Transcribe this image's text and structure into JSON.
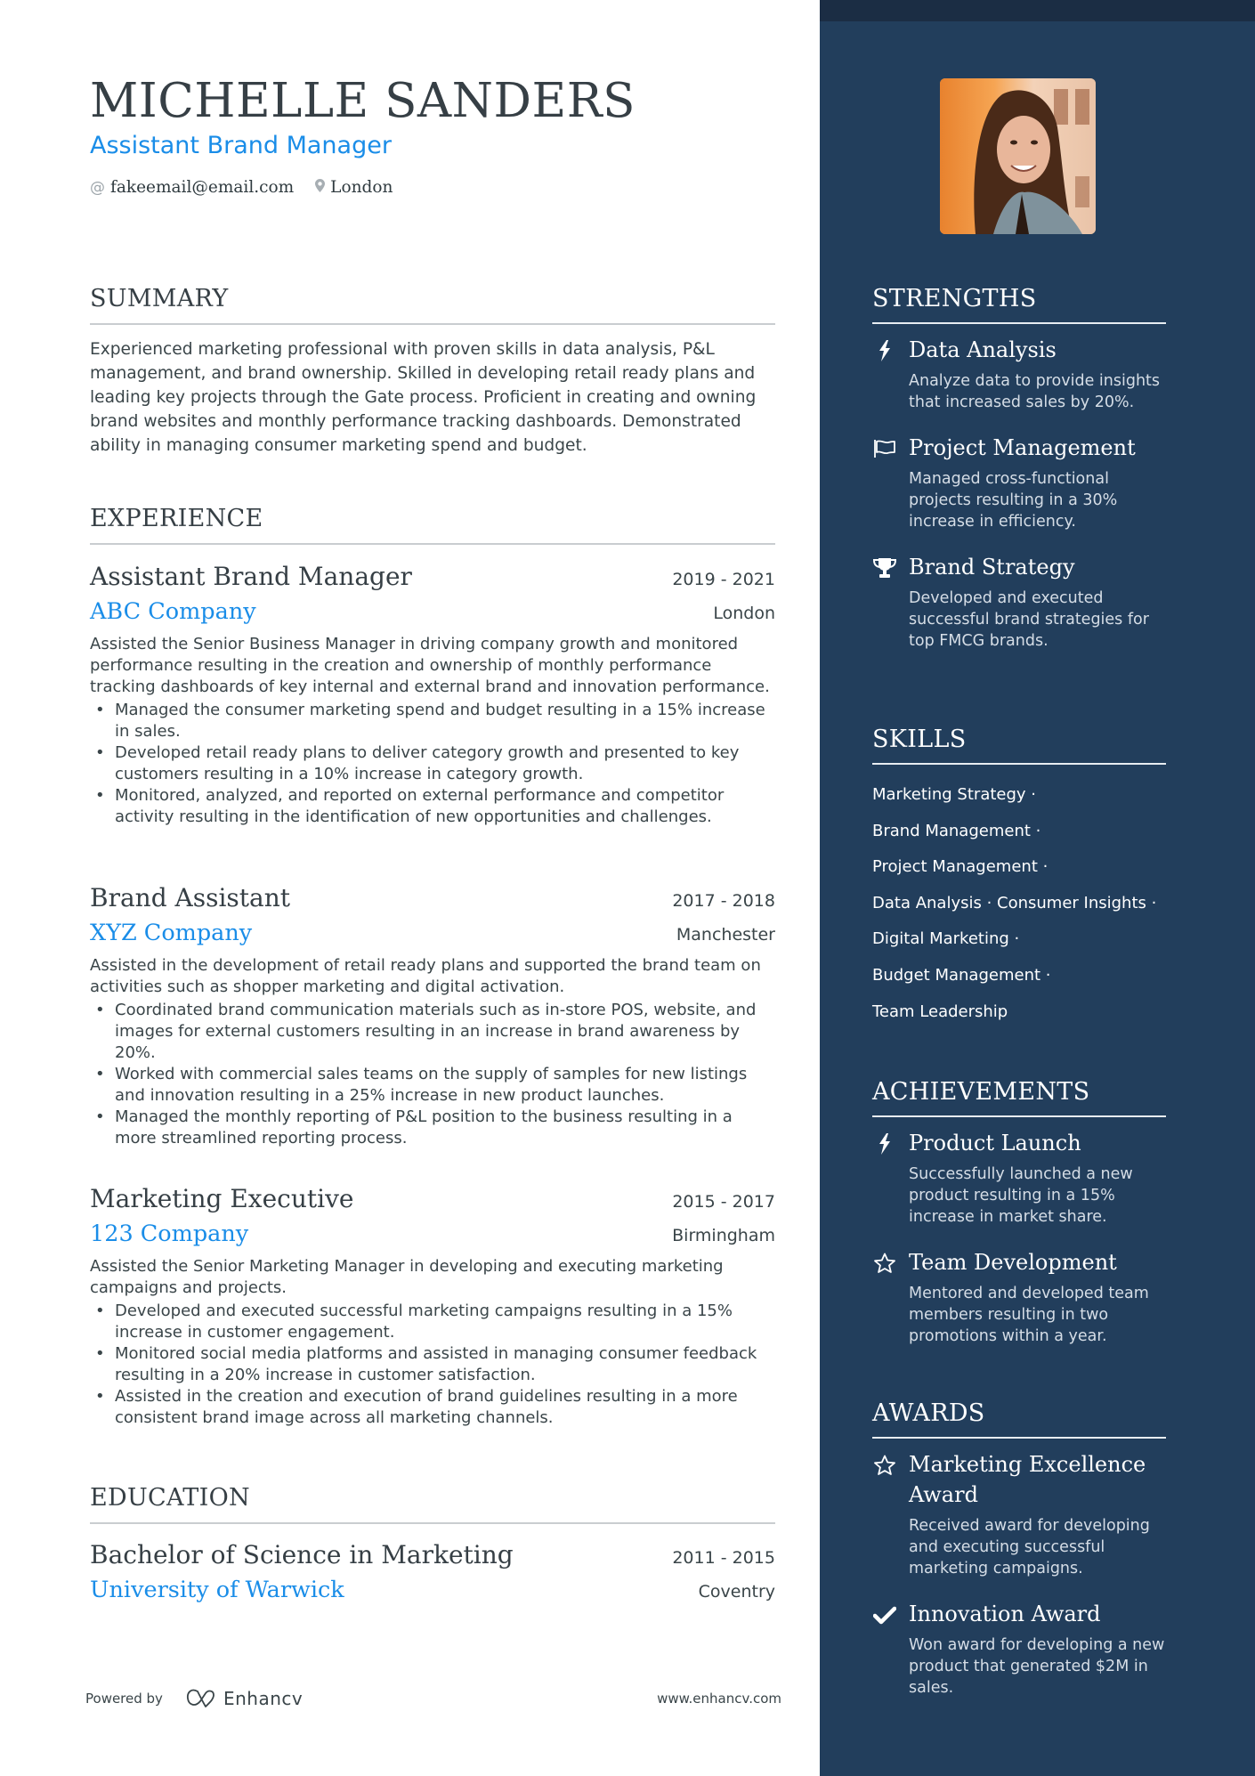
{
  "header": {
    "name": "MICHELLE SANDERS",
    "title": "Assistant Brand Manager",
    "email": "fakeemail@email.com",
    "location": "London",
    "email_icon": "at-icon",
    "location_icon": "map-pin-icon"
  },
  "summary": {
    "heading": "SUMMARY",
    "text": "Experienced marketing professional with proven skills in data analysis, P&L management, and brand ownership. Skilled in developing retail ready plans and leading key projects through the Gate process. Proficient in creating and owning brand websites and monthly performance tracking dashboards. Demonstrated ability in managing consumer marketing spend and budget."
  },
  "experience": {
    "heading": "EXPERIENCE",
    "jobs": [
      {
        "title": "Assistant Brand Manager",
        "dates": "2019 - 2021",
        "company": "ABC Company",
        "location": "London",
        "description": "Assisted the Senior Business Manager in driving company growth and monitored performance resulting in the creation and ownership of monthly performance tracking dashboards of key internal and external brand and innovation performance.",
        "bullets": [
          "Managed the consumer marketing spend and budget resulting in a 15% increase in sales.",
          "Developed retail ready plans to deliver category growth and presented to key customers resulting in a 10% increase in category growth.",
          "Monitored, analyzed, and reported on external performance and competitor activity resulting in the identification of new opportunities and challenges."
        ]
      },
      {
        "title": "Brand Assistant",
        "dates": "2017 - 2018",
        "company": "XYZ Company",
        "location": "Manchester",
        "description": "Assisted in the development of retail ready plans and supported the brand team on activities such as shopper marketing and digital activation.",
        "bullets": [
          "Coordinated brand communication materials such as in-store POS, website, and images for external customers resulting in an increase in brand awareness by 20%.",
          "Worked with commercial sales teams on the supply of samples for new listings and innovation resulting in a 25% increase in new product launches.",
          "Managed the monthly reporting of P&L position to the business resulting in a more streamlined reporting process."
        ]
      },
      {
        "title": "Marketing Executive",
        "dates": "2015 - 2017",
        "company": "123 Company",
        "location": "Birmingham",
        "description": "Assisted the Senior Marketing Manager in developing and executing marketing campaigns and projects.",
        "bullets": [
          "Developed and executed successful marketing campaigns resulting in a 15% increase in customer engagement.",
          "Monitored social media platforms and assisted in managing consumer feedback resulting in a 20% increase in customer satisfaction.",
          "Assisted in the creation and execution of brand guidelines resulting in a more consistent brand image across all marketing channels."
        ]
      }
    ]
  },
  "education": {
    "heading": "EDUCATION",
    "degree": "Bachelor of Science in Marketing",
    "dates": "2011 - 2015",
    "school": "University of Warwick",
    "location": "Coventry"
  },
  "strengths": {
    "heading": "STRENGTHS",
    "items": [
      {
        "icon": "lightning-icon",
        "title": "Data Analysis",
        "text": "Analyze data to provide insights that increased sales by 20%."
      },
      {
        "icon": "flag-icon",
        "title": "Project Management",
        "text": "Managed cross-functional projects resulting in a 30% increase in efficiency."
      },
      {
        "icon": "trophy-icon",
        "title": "Brand Strategy",
        "text": "Developed and executed successful brand strategies for top FMCG brands."
      }
    ]
  },
  "skills": {
    "heading": "SKILLS",
    "lines": [
      "Marketing Strategy ·",
      "Brand Management ·",
      "Project Management ·",
      "Data Analysis · Consumer Insights ·",
      "Digital Marketing ·",
      "Budget Management ·",
      "Team Leadership"
    ]
  },
  "achievements": {
    "heading": "ACHIEVEMENTS",
    "items": [
      {
        "icon": "lightning-icon",
        "title": "Product Launch",
        "text": "Successfully launched a new product resulting in a 15% increase in market share."
      },
      {
        "icon": "star-icon",
        "title": "Team Development",
        "text": "Mentored and developed team members resulting in two promotions within a year."
      }
    ]
  },
  "awards": {
    "heading": "AWARDS",
    "items": [
      {
        "icon": "star-icon",
        "title": "Marketing Excellence Award",
        "text": "Received award for developing and executing successful marketing campaigns."
      },
      {
        "icon": "checkmark-icon",
        "title": "Innovation Award",
        "text": "Won award for developing a new product that generated $2M in sales."
      }
    ]
  },
  "footer": {
    "powered_by": "Powered by",
    "brand": "Enhancv",
    "website": "www.enhancv.com"
  },
  "colors": {
    "accent": "#1a8de8",
    "sidebar": "#223e5c",
    "sidebar_band": "#1b2d44",
    "text": "#363f45"
  }
}
